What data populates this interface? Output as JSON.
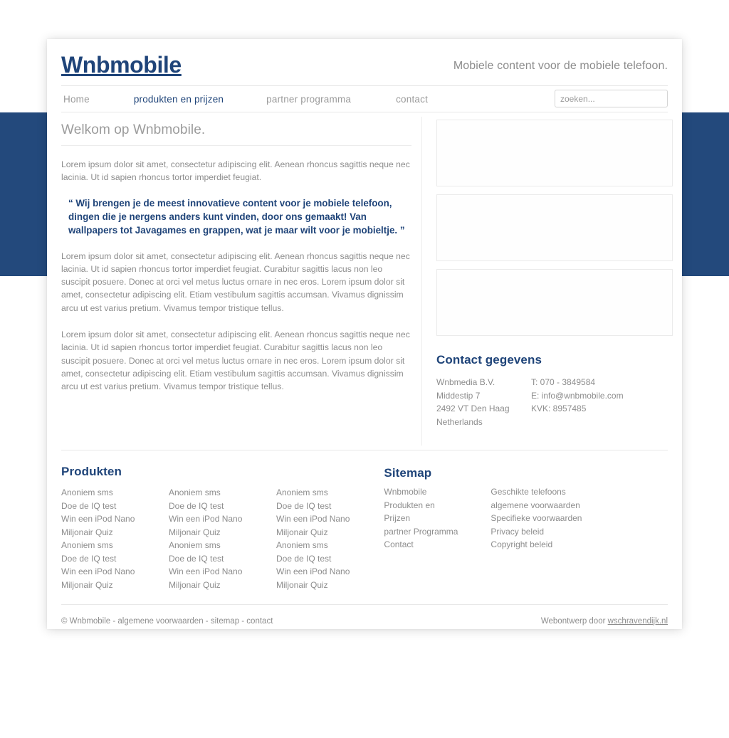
{
  "site": {
    "logo": "Wnbmobile",
    "tagline": "Mobiele content voor de mobiele telefoon."
  },
  "nav": {
    "items": [
      {
        "label": "Home",
        "active": false
      },
      {
        "label": "produkten en prijzen",
        "active": true
      },
      {
        "label": "partner programma",
        "active": false
      },
      {
        "label": "contact",
        "active": false
      }
    ]
  },
  "search": {
    "placeholder": "zoeken...",
    "value": "",
    "button_icon": "search-icon"
  },
  "main": {
    "title": "Welkom op Wnbmobile.",
    "intro": "Lorem ipsum dolor sit amet, consectetur adipiscing elit. Aenean rhoncus sagittis neque nec lacinia. Ut id sapien rhoncus tortor imperdiet feugiat.",
    "quote": "“ Wij brengen je de meest innovatieve content voor je mobiele telefoon, dingen die je nergens anders kunt vinden, door ons gemaakt! Van wallpapers tot Javagames en grappen, wat je maar wilt voor je mobieltje. ”",
    "paragraph2": "Lorem ipsum dolor sit amet, consectetur adipiscing elit. Aenean rhoncus sagittis neque nec lacinia. Ut id sapien rhoncus tortor imperdiet feugiat. Curabitur sagittis lacus non leo suscipit posuere. Donec at orci vel metus luctus ornare in nec eros. Lorem ipsum dolor sit amet, consectetur adipiscing elit. Etiam vestibulum sagittis accumsan. Vivamus dignissim arcu ut est varius pretium. Vivamus tempor tristique tellus.",
    "paragraph3": "Lorem ipsum dolor sit amet, consectetur adipiscing elit. Aenean rhoncus sagittis neque nec lacinia. Ut id sapien rhoncus tortor imperdiet feugiat. Curabitur sagittis lacus non leo suscipit posuere. Donec at orci vel metus luctus ornare in nec eros. Lorem ipsum dolor sit amet, consectetur adipiscing elit. Etiam vestibulum sagittis accumsan. Vivamus dignissim arcu ut est varius pretium. Vivamus tempor tristique tellus."
  },
  "sidebar": {
    "boxes": [
      {
        "content": ""
      },
      {
        "content": ""
      },
      {
        "content": ""
      }
    ],
    "contact": {
      "title": "Contact gegevens",
      "address": [
        "Wnbmedia B.V.",
        "Middestip 7",
        "2492 VT Den Haag",
        "Netherlands"
      ],
      "details": [
        "T: 070 - 3849584",
        "E: info@wnbmobile.com",
        "KVK: 8957485"
      ]
    }
  },
  "footer": {
    "produkten": {
      "heading": "Produkten",
      "columns": [
        [
          "Anoniem sms",
          "Doe de IQ test",
          "Win een iPod Nano",
          "Miljonair Quiz",
          "Anoniem sms",
          "Doe de IQ test",
          "Win een iPod Nano",
          "Miljonair Quiz"
        ],
        [
          "Anoniem sms",
          "Doe de IQ test",
          "Win een iPod Nano",
          "Miljonair Quiz",
          "Anoniem sms",
          "Doe de IQ test",
          "Win een iPod Nano",
          "Miljonair Quiz"
        ],
        [
          "Anoniem sms",
          "Doe de IQ test",
          "Win een iPod Nano",
          "Miljonair Quiz",
          "Anoniem sms",
          "Doe de IQ test",
          "Win een iPod Nano",
          "Miljonair Quiz"
        ]
      ]
    },
    "sitemap": {
      "heading": "Sitemap",
      "columns": [
        [
          "Wnbmobile",
          "Produkten en",
          "Prijzen",
          "partner Programma",
          "Contact"
        ],
        [
          "Geschikte telefoons",
          "algemene voorwaarden",
          "Specifieke voorwaarden",
          "Privacy beleid",
          "Copyright beleid"
        ]
      ]
    },
    "copyright": "© Wnbmobile - algemene voorwaarden - sitemap - contact",
    "credit_prefix": "Webontwerp door ",
    "credit_link": "wschravendijk.nl"
  },
  "colors": {
    "brand_blue": "#1f4479",
    "band_blue": "#23497c",
    "muted_text": "#8d8d8d",
    "border": "#ececec"
  }
}
